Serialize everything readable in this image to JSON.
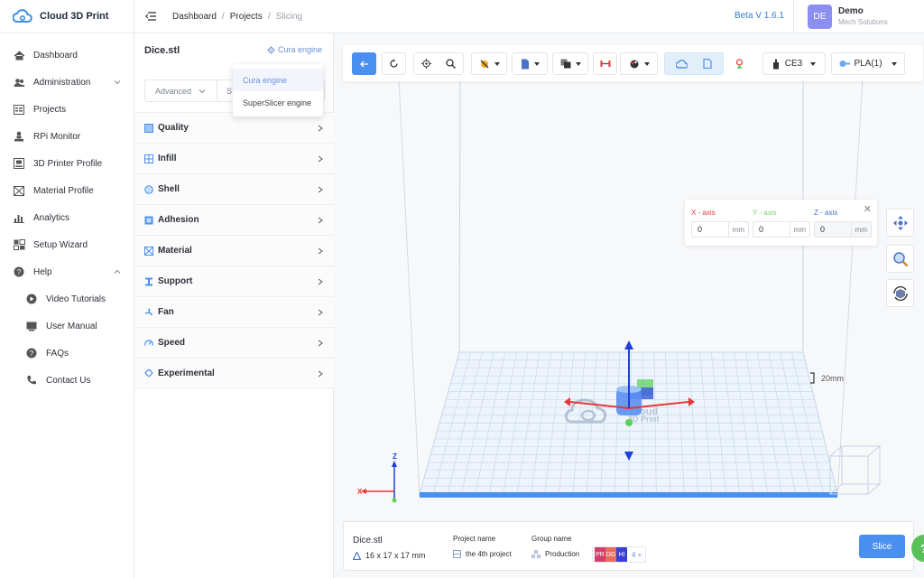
{
  "app": {
    "name": "Cloud 3D Print"
  },
  "sidebar": {
    "items": [
      {
        "label": "Dashboard",
        "icon": "home-icon"
      },
      {
        "label": "Administration",
        "icon": "users-icon",
        "expandable": true
      },
      {
        "label": "Projects",
        "icon": "projects-icon"
      },
      {
        "label": "RPi Monitor",
        "icon": "monitor-icon"
      },
      {
        "label": "3D Printer Profile",
        "icon": "printer-icon"
      },
      {
        "label": "Material Profile",
        "icon": "material-icon"
      },
      {
        "label": "Analytics",
        "icon": "chart-icon"
      },
      {
        "label": "Setup Wizard",
        "icon": "wizard-icon"
      },
      {
        "label": "Help",
        "icon": "help-icon",
        "expanded": true
      }
    ],
    "help_children": [
      {
        "label": "Video Tutorials",
        "icon": "play-icon"
      },
      {
        "label": "User Manual",
        "icon": "manual-icon"
      },
      {
        "label": "FAQs",
        "icon": "faq-icon"
      },
      {
        "label": "Contact Us",
        "icon": "phone-icon"
      }
    ]
  },
  "topbar": {
    "breadcrumbs": [
      "Dashboard",
      "Projects",
      "Slicing"
    ],
    "version": "Beta V 1.6.1",
    "user": {
      "initials": "DE",
      "name": "Demo",
      "org": "Mech Solutions"
    }
  },
  "panel": {
    "file_title": "Dice.stl",
    "engine_label": "Cura engine",
    "mode": "Advanced",
    "mode2_initial": "S",
    "sections": [
      "Quality",
      "Infill",
      "Shell",
      "Adhesion",
      "Material",
      "Support",
      "Fan",
      "Speed",
      "Experimental"
    ]
  },
  "engine_dropdown": {
    "options": [
      "Cura engine",
      "SuperSlicer engine"
    ],
    "selected": "Cura engine"
  },
  "toolbar": {
    "printer": "CE3",
    "material": "PLA(1)"
  },
  "axis_panel": {
    "x_label": "X - axis",
    "y_label": "Y - axis",
    "z_label": "Z - axis",
    "x_value": "0",
    "y_value": "0",
    "z_value": "0",
    "unit": "mm"
  },
  "scene": {
    "scale_label": "20mm",
    "watermark_line1": "Cloud",
    "watermark_line2": "3D Print",
    "gizmo_x": "X",
    "gizmo_z": "Z"
  },
  "bottom": {
    "file_name": "Dice.stl",
    "dimensions": "16 x 17 x 17 mm",
    "project_label": "Project name",
    "project_value": "the 4th project",
    "group_label": "Group name",
    "group_value": "Production",
    "tags": [
      {
        "text": "PR",
        "color": "#d63d6a"
      },
      {
        "text": "DG",
        "color": "#e96b5e"
      },
      {
        "text": "HI",
        "color": "#3b3fd8"
      }
    ],
    "more_tags": "4 +",
    "slice_label": "Slice",
    "help_fab": "?"
  },
  "colors": {
    "accent": "#4a90f0",
    "x_axis": "#e53935",
    "y_axis": "#7ed36a",
    "z_axis": "#1e3fd8",
    "bed_edge": "#4a90f0"
  }
}
